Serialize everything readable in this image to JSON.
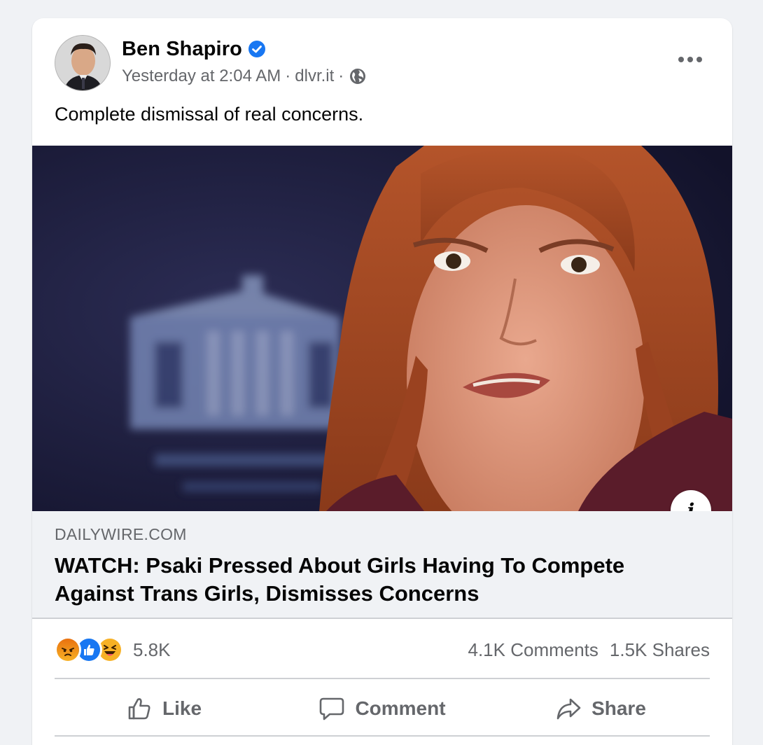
{
  "post": {
    "author": "Ben Shapiro",
    "timestamp": "Yesterday at 2:04 AM",
    "separator": "·",
    "source": "dlvr.it",
    "visibility_icon": "globe-icon",
    "verified_icon": "verified-badge-icon",
    "text": "Complete dismissal of real concerns."
  },
  "link": {
    "domain": "DAILYWIRE.COM",
    "title": "WATCH: Psaki Pressed About Girls Having To Compete Against Trans Girls, Dismisses Concerns",
    "info_label": "i"
  },
  "stats": {
    "reactions": [
      "angry",
      "like",
      "haha"
    ],
    "reaction_count": "5.8K",
    "comments": "4.1K Comments",
    "shares": "1.5K Shares"
  },
  "actions": {
    "like": "Like",
    "comment": "Comment",
    "share": "Share"
  },
  "colors": {
    "verified": "#1877f2",
    "like_blue": "#1877f2",
    "reaction_yellow": "#f7b125",
    "angry_orange": "#e9710f",
    "secondary_text": "#65676b",
    "background": "#f0f2f5"
  }
}
